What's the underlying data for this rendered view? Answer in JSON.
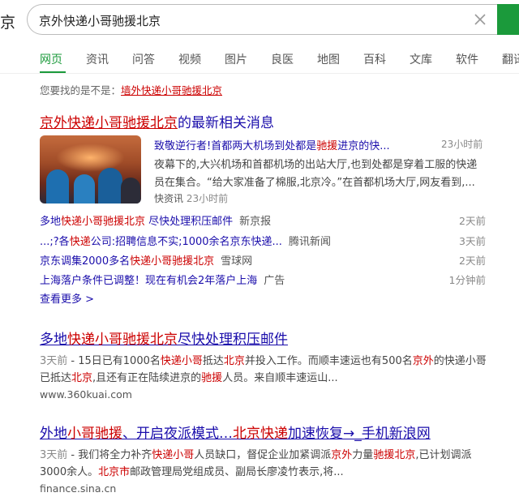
{
  "header": {
    "logo_fragment": "京",
    "query": "京外快递小哥驰援北京"
  },
  "tabs": [
    "网页",
    "资讯",
    "问答",
    "视频",
    "图片",
    "良医",
    "地图",
    "百科",
    "文库",
    "软件",
    "翻译"
  ],
  "suggest": {
    "prefix": "您要找的是不是：",
    "query": "墙外快递小哥驰援北京"
  },
  "news": {
    "title_highlight": "京外快递小哥驰援北京",
    "title_suffix": "的最新相关消息",
    "lead": {
      "head_a": "致敬逆行者!首都两大机场到处都是",
      "head_b": "驰援",
      "head_c": "进京的快...",
      "time": "23小时前",
      "line2": "夜幕下的,大兴机场和首都机场的出站大厅,也到处都是穿着工服的快递",
      "line3": "员在集合。“给大家准备了棉服,北京冷。”在首都机场大厅,网友看到,...",
      "source": "快资讯",
      "source_time": "23小时前"
    },
    "items": [
      {
        "t1": "多地",
        "t2": "快递小哥驰援北京",
        "t3": " 尽快处理积压邮件",
        "src": "新京报",
        "time": "2天前"
      },
      {
        "t1": "...;?各",
        "t2": "快递",
        "t3": "公司:招聘信息不实;1000余名京东快递...",
        "src": "腾讯新闻",
        "time": "3天前"
      },
      {
        "t1": "京东调集2000多名",
        "t2": "快递小哥驰援北京",
        "t3": "",
        "src": "雪球网",
        "time": "2天前"
      },
      {
        "t1": "上海落户条件已调整！现在有机会2年落户上海",
        "t2": "",
        "t3": "",
        "src": "广告",
        "time": "1分钟前"
      }
    ],
    "more": "查看更多 >"
  },
  "results": [
    {
      "title_a": "多地",
      "title_b": "快递小哥驰援北京",
      "title_c": "尽快处理积压邮件",
      "snip1_date": "3天前",
      "snip1_a": " - 15日已有1000名",
      "snip1_b": "快递小哥",
      "snip1_c": "抵达",
      "snip1_d": "北京",
      "snip1_e": "并投入工作。而顺丰速运也有500名",
      "snip1_f": "京外",
      "snip1_g": "的快递小哥",
      "snip2_a": "已抵达",
      "snip2_b": "北京",
      "snip2_c": ",且还有正在陆续进京的",
      "snip2_d": "驰援",
      "snip2_e": "人员。来自顺丰速运山...",
      "url": "www.360kuai.com"
    },
    {
      "title_a": "外地",
      "title_b": "小哥驰援",
      "title_c": "、开启夜派模式…",
      "title_d": "北京快递",
      "title_e": "加速恢复→_手机新浪网",
      "snip1_date": "3天前",
      "snip1_a": " - 我们将全力补齐",
      "snip1_b": "快递小哥",
      "snip1_c": "人员缺口，督促企业加紧调派",
      "snip1_d": "京外",
      "snip1_e": "力量",
      "snip1_f": "驰援北京",
      "snip1_g": ",已计划调派",
      "snip2_a": "3000余人。",
      "snip2_b": "北京市",
      "snip2_c": "邮政管理局党组成员、副局长廖凌竹表示,将...",
      "url": "finance.sina.cn"
    }
  ],
  "colors": {
    "accent": "#1b9a3b",
    "highlight": "#c00000",
    "link": "#1a0dab"
  }
}
